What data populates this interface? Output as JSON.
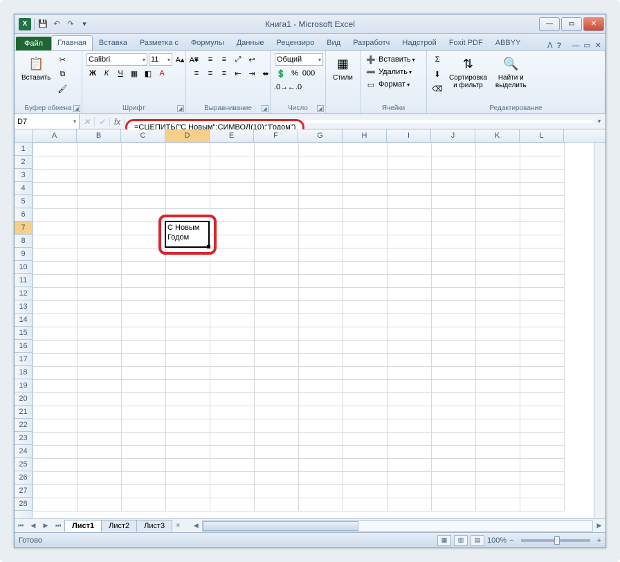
{
  "title": "Книга1 - Microsoft Excel",
  "qat_icon_label": "X",
  "tabs": {
    "file": "Файл",
    "items": [
      "Главная",
      "Вставка",
      "Разметка с",
      "Формулы",
      "Данные",
      "Рецензиро",
      "Вид",
      "Разработч",
      "Надстрой",
      "Foxit PDF",
      "ABBYY"
    ],
    "active_index": 0
  },
  "ribbon": {
    "clipboard": {
      "paste": "Вставить",
      "label": "Буфер обмена"
    },
    "font": {
      "name": "Calibri",
      "size": "11",
      "bold": "Ж",
      "italic": "К",
      "underline": "Ч",
      "label": "Шрифт"
    },
    "align": {
      "label": "Выравнивание"
    },
    "number": {
      "format": "Общий",
      "label": "Число"
    },
    "styles": {
      "btn": "Стили"
    },
    "cells": {
      "insert": "Вставить",
      "delete": "Удалить",
      "format": "Формат",
      "label": "Ячейки"
    },
    "editing": {
      "sort": "Сортировка\nи фильтр",
      "find": "Найти и\nвыделить",
      "label": "Редактирование"
    }
  },
  "namebox": "D7",
  "formula": "=СЦЕПИТЬ(\"С Новым\";СИМВОЛ(10);\"Годом\")",
  "columns": [
    "A",
    "B",
    "C",
    "D",
    "E",
    "F",
    "G",
    "H",
    "I",
    "J",
    "K",
    "L"
  ],
  "rows": [
    "1",
    "2",
    "3",
    "4",
    "5",
    "6",
    "7",
    "8",
    "9",
    "10",
    "11",
    "12",
    "13",
    "14",
    "15",
    "16",
    "17",
    "18",
    "19",
    "20",
    "21",
    "22",
    "23",
    "24",
    "25",
    "26",
    "27",
    "28"
  ],
  "selected_col_index": 3,
  "selected_row_index": 6,
  "cell_content": "С Новым\nГодом",
  "sheets": [
    "Лист1",
    "Лист2",
    "Лист3"
  ],
  "active_sheet_index": 0,
  "status_text": "Готово",
  "zoom": "100%"
}
